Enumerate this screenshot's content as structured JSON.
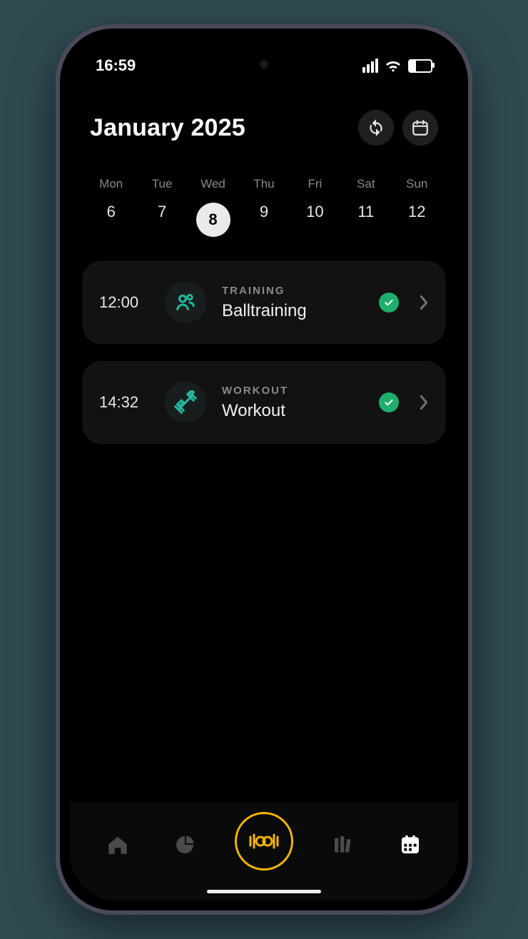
{
  "status": {
    "time": "16:59"
  },
  "header": {
    "title": "January 2025"
  },
  "week": {
    "days": [
      {
        "label": "Mon",
        "num": "6",
        "selected": false
      },
      {
        "label": "Tue",
        "num": "7",
        "selected": false
      },
      {
        "label": "Wed",
        "num": "8",
        "selected": true
      },
      {
        "label": "Thu",
        "num": "9",
        "selected": false
      },
      {
        "label": "Fri",
        "num": "10",
        "selected": false
      },
      {
        "label": "Sat",
        "num": "11",
        "selected": false
      },
      {
        "label": "Sun",
        "num": "12",
        "selected": false
      }
    ]
  },
  "events": [
    {
      "time": "12:00",
      "category": "TRAINING",
      "name": "Balltraining",
      "icon": "group",
      "done": true
    },
    {
      "time": "14:32",
      "category": "WORKOUT",
      "name": "Workout",
      "icon": "dumbbell",
      "done": true
    }
  ],
  "colors": {
    "accent": "#1fae6d",
    "teal": "#26b59c",
    "highlight": "#f5b400"
  },
  "tabs": [
    "home",
    "stats",
    "workout",
    "library",
    "calendar"
  ],
  "activeTab": "calendar"
}
